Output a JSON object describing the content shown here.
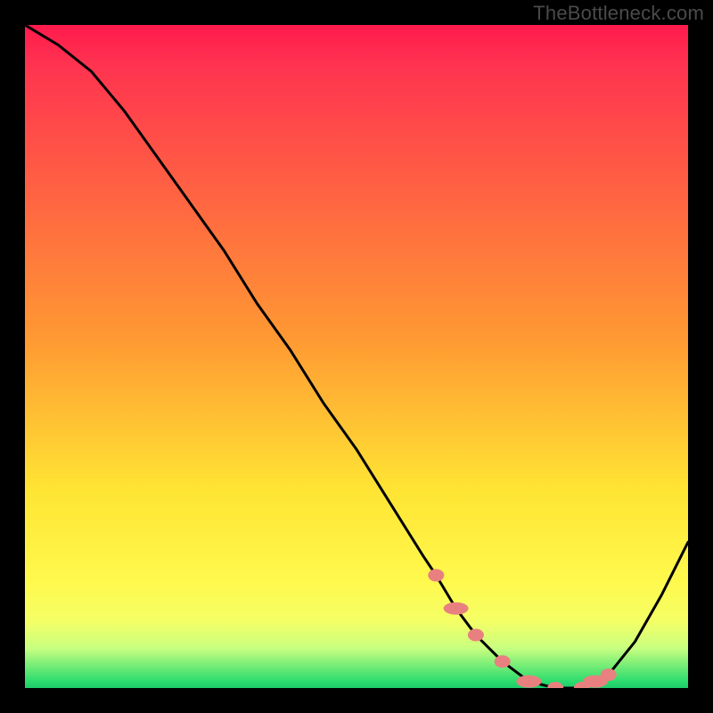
{
  "watermark": "TheBottleneck.com",
  "chart_data": {
    "type": "line",
    "title": "",
    "xlabel": "",
    "ylabel": "",
    "xlim": [
      0,
      100
    ],
    "ylim": [
      0,
      100
    ],
    "x": [
      0,
      5,
      10,
      15,
      20,
      25,
      30,
      35,
      40,
      45,
      50,
      55,
      60,
      62,
      65,
      68,
      72,
      76,
      80,
      84,
      86,
      88,
      92,
      96,
      100
    ],
    "values": [
      100,
      97,
      93,
      87,
      80,
      73,
      66,
      58,
      51,
      43,
      36,
      28,
      20,
      17,
      12,
      8,
      4,
      1,
      0,
      0,
      1,
      2,
      7,
      14,
      22
    ],
    "marker_points_x": [
      62,
      65,
      68,
      72,
      76,
      80,
      84,
      86,
      88
    ],
    "marker_points_y": [
      17,
      12,
      8,
      4,
      1,
      0,
      0,
      1,
      2
    ],
    "marker_color": "#e98080",
    "line_color": "#000000",
    "gradient_stops": [
      {
        "pos": 0,
        "color": "#ff1a4d"
      },
      {
        "pos": 47,
        "color": "#ff9833"
      },
      {
        "pos": 84,
        "color": "#fff94d"
      },
      {
        "pos": 100,
        "color": "#1ec96a"
      }
    ]
  }
}
